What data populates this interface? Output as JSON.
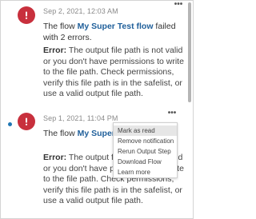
{
  "notifications": [
    {
      "unread": false,
      "timestamp": "Sep 2, 2021, 12:03 AM",
      "message_prefix": "The flow ",
      "flow_name": "My Super Test flow",
      "message_suffix": " failed with 2 errors.",
      "error_label": "Error:",
      "error_text": " The output file path is not valid or you don't have permissions to write to the file path. Check permissions, verify this file path is in the safelist, or use a valid output file path.",
      "more_label": "•••"
    },
    {
      "unread": true,
      "timestamp": "Sep 1, 2021, 11:04 PM",
      "message_prefix": "The flow ",
      "flow_name": "My Super Tes",
      "message_suffix": "",
      "error_label": "Error:",
      "error_text": " The output file path is not valid or you don't have permissions to write to the file path. Check permissions, verify this file path is in the safelist, or use a valid output file path.",
      "more_label": "•••"
    }
  ],
  "context_menu": {
    "items": [
      "Mark as read",
      "Remove notification",
      "Rerun Output Step",
      "Download Flow",
      "Learn more"
    ],
    "highlighted_index": 0
  },
  "colors": {
    "alert_red": "#c8303d",
    "link_blue": "#1f5f9a",
    "unread_dot": "#1f77b4"
  },
  "icons": {
    "alert": "exclamation-circle-icon",
    "more": "more-options-icon"
  }
}
